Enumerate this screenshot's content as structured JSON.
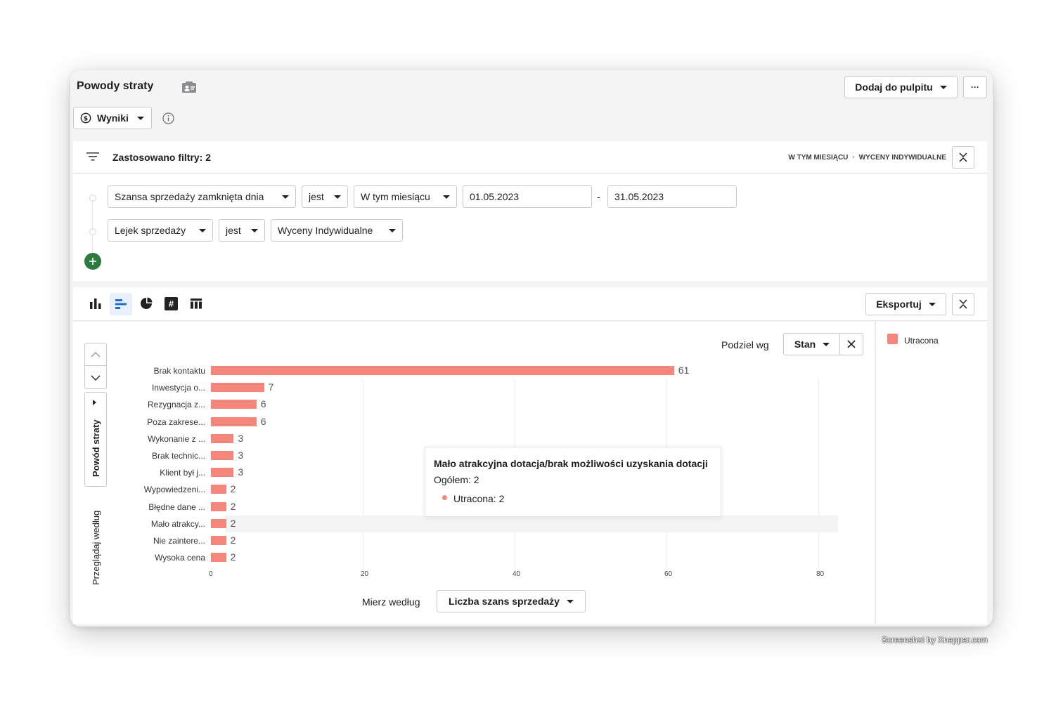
{
  "header": {
    "title": "Powody straty",
    "add_to_dashboard": "Dodaj do pulpitu",
    "more": "···",
    "results_label": "Wyniki"
  },
  "filters": {
    "summary": "Zastosowano filtry: 2",
    "tag1": "W TYM MIESIĄCU",
    "sep": "·",
    "tag2": "WYCENY INDYWIDUALNE",
    "row1": {
      "field": "Szansa sprzedaży zamknięta dnia",
      "op": "jest",
      "range": "W tym miesiącu",
      "from": "01.05.2023",
      "dash": "-",
      "to": "31.05.2023"
    },
    "row2": {
      "field": "Lejek sprzedaży",
      "op": "jest",
      "value": "Wyceny Indywidualne"
    }
  },
  "toolbar": {
    "export": "Eksportuj"
  },
  "split": {
    "label": "Podziel wg",
    "value": "Stan"
  },
  "measure": {
    "label": "Mierz według",
    "value": "Liczba szans sprzedaży"
  },
  "side": {
    "dimension": "Powód straty",
    "browse": "Przeglądaj według"
  },
  "legend": {
    "series": "Utracona",
    "color": "#f4867c"
  },
  "tooltip": {
    "title": "Mało atrakcyjna dotacja/brak możliwości uzyskania dotacji",
    "total": "Ogółem: 2",
    "series": "Utracona: 2"
  },
  "chart_data": {
    "type": "bar",
    "orientation": "horizontal",
    "categories": [
      "Brak kontaktu",
      "Inwestycja o...",
      "Rezygnacja z...",
      "Poza zakrese...",
      "Wykonanie z ...",
      "Brak technic...",
      "Klient był j...",
      "Wypowiedzeni...",
      "Błędne dane ...",
      "Mało atrakcy...",
      "Nie zaintere...",
      "Wysoka cena"
    ],
    "series": [
      {
        "name": "Utracona",
        "values": [
          61,
          7,
          6,
          6,
          3,
          3,
          3,
          2,
          2,
          2,
          2,
          2
        ]
      }
    ],
    "xticks": [
      "0",
      "20",
      "40",
      "60",
      "80"
    ],
    "xlim": [
      0,
      80
    ],
    "grid": true,
    "legend": "right"
  },
  "watermark": "Screenshot by Xnapper.com"
}
